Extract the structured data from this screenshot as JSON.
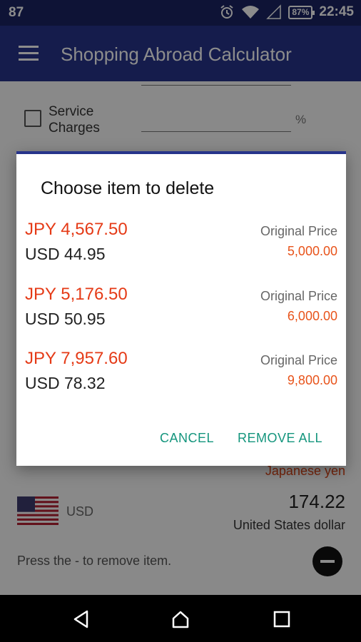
{
  "status_bar": {
    "left_text": "87",
    "battery": "87%",
    "time": "22:45"
  },
  "app_bar": {
    "title": "Shopping Abroad Calculator",
    "menu_icon": "hamburger-menu-icon"
  },
  "background": {
    "service_charges_label": "Service Charges",
    "service_charges_unit": "%",
    "jpy_currency_name": "Japanese yen",
    "usd_code": "USD",
    "usd_amount": "174.22",
    "usd_currency_name": "United States dollar",
    "hint": "Press the - to remove item."
  },
  "dialog": {
    "title": "Choose item to delete",
    "items": [
      {
        "jpy": "JPY 4,567.50",
        "usd": "USD 44.95",
        "orig_label": "Original Price",
        "orig_price": "5,000.00"
      },
      {
        "jpy": "JPY 5,176.50",
        "usd": "USD 50.95",
        "orig_label": "Original Price",
        "orig_price": "6,000.00"
      },
      {
        "jpy": "JPY 7,957.60",
        "usd": "USD 78.32",
        "orig_label": "Original Price",
        "orig_price": "9,800.00"
      }
    ],
    "cancel_label": "CANCEL",
    "remove_all_label": "REMOVE ALL"
  },
  "colors": {
    "app_bar": "#27348b",
    "status_bar": "#1a2463",
    "jpy_text": "#e53a16",
    "original_price": "#e8531a",
    "dialog_button": "#14957d"
  },
  "nav_bar": {
    "icons": [
      "back-icon",
      "home-icon",
      "recents-icon"
    ]
  }
}
